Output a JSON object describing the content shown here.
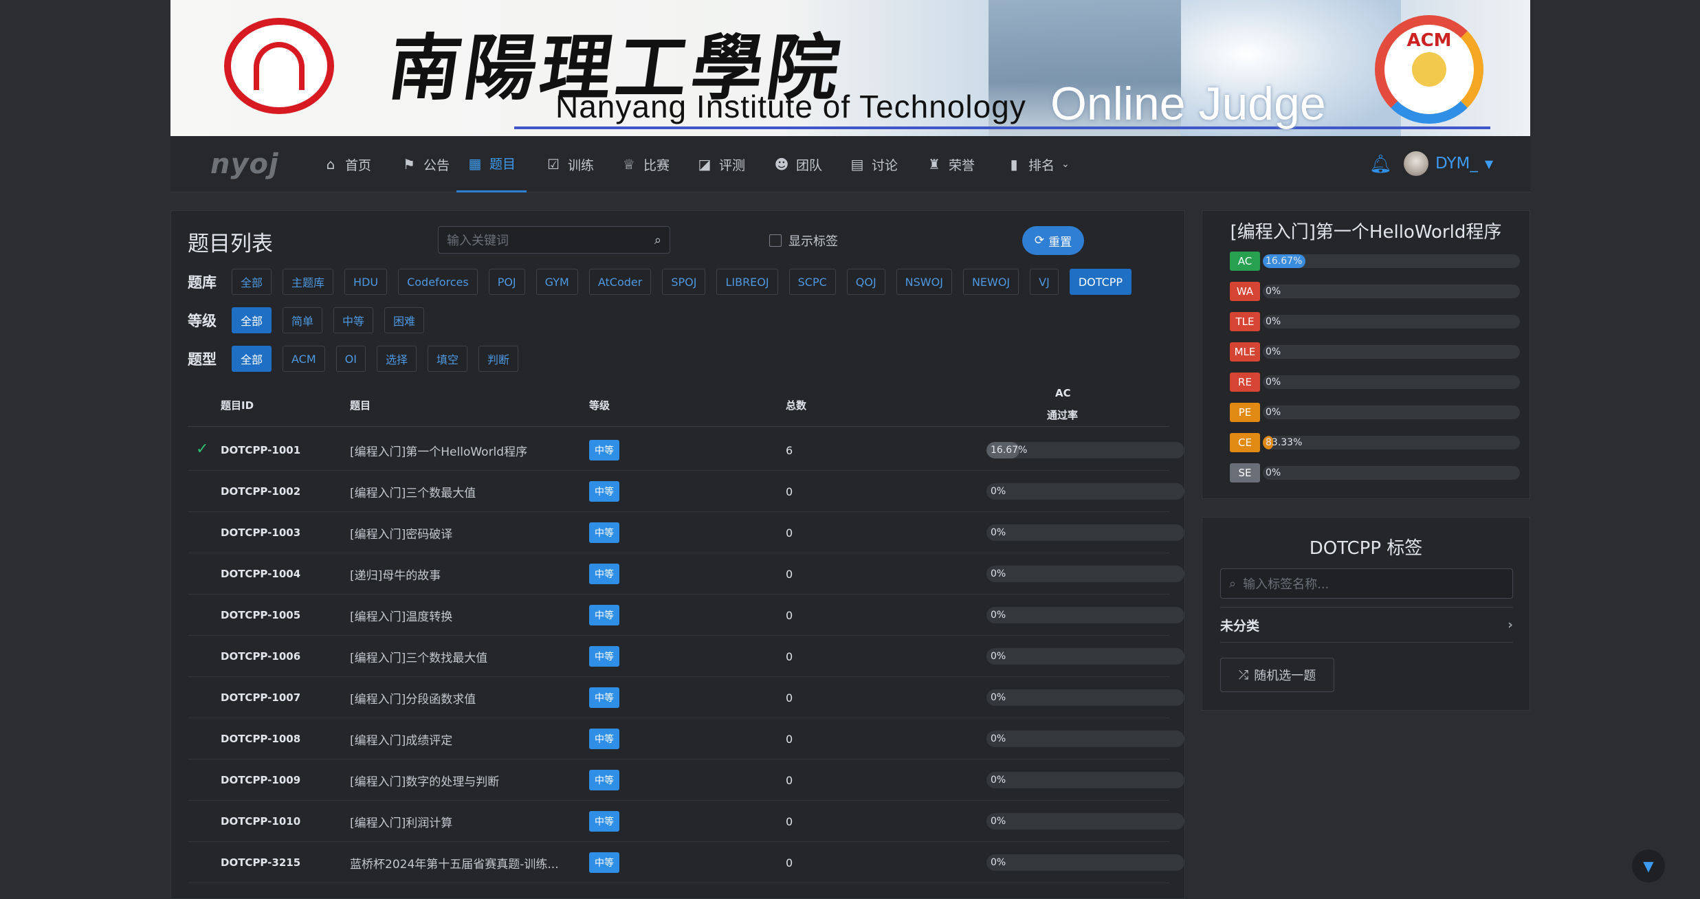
{
  "banner": {
    "calligraphy": "南陽理工學院",
    "school_en": "Nanyang Institute of Technology",
    "oj": "Online Judge",
    "acm": "ACM"
  },
  "nav": {
    "logo": "nyoj",
    "items": [
      {
        "label": "首页",
        "icon": "home-icon"
      },
      {
        "label": "公告",
        "icon": "flag-icon"
      },
      {
        "label": "题目",
        "icon": "grid-icon"
      },
      {
        "label": "训练",
        "icon": "clipboard-check-icon"
      },
      {
        "label": "比赛",
        "icon": "trophy-icon"
      },
      {
        "label": "评测",
        "icon": "chart-icon"
      },
      {
        "label": "团队",
        "icon": "users-icon"
      },
      {
        "label": "讨论",
        "icon": "comment-icon"
      },
      {
        "label": "荣誉",
        "icon": "medal-icon"
      },
      {
        "label": "排名",
        "icon": "bar-chart-icon"
      }
    ],
    "active": "题目",
    "user": "DYM_"
  },
  "main": {
    "title": "题目列表",
    "search_placeholder": "输入关键词",
    "show_tags": "显示标签",
    "reset": "重置",
    "filters": {
      "source_label": "题库",
      "sources": [
        "全部",
        "主题库",
        "HDU",
        "Codeforces",
        "POJ",
        "GYM",
        "AtCoder",
        "SPOJ",
        "LIBREOJ",
        "SCPC",
        "QOJ",
        "NSWOJ",
        "NEWOJ",
        "VJ",
        "DOTCPP"
      ],
      "source_active": "DOTCPP",
      "level_label": "等级",
      "levels": [
        "全部",
        "简单",
        "中等",
        "困难"
      ],
      "level_active": "全部",
      "type_label": "题型",
      "types": [
        "全部",
        "ACM",
        "OI",
        "选择",
        "填空",
        "判断"
      ],
      "type_active": "全部"
    },
    "columns": {
      "id": "题目ID",
      "title": "题目",
      "level": "等级",
      "total": "总数",
      "ac_top": "AC",
      "ac_bottom": "通过率"
    },
    "rows": [
      {
        "id": "DOTCPP-1001",
        "title": "[编程入门]第一个HelloWorld程序",
        "level": "中等",
        "total": "6",
        "rate": "16.67%",
        "rate_value": 16.67,
        "solved": true
      },
      {
        "id": "DOTCPP-1002",
        "title": "[编程入门]三个数最大值",
        "level": "中等",
        "total": "0",
        "rate": "0%",
        "rate_value": 0,
        "solved": false
      },
      {
        "id": "DOTCPP-1003",
        "title": "[编程入门]密码破译",
        "level": "中等",
        "total": "0",
        "rate": "0%",
        "rate_value": 0,
        "solved": false
      },
      {
        "id": "DOTCPP-1004",
        "title": "[递归]母牛的故事",
        "level": "中等",
        "total": "0",
        "rate": "0%",
        "rate_value": 0,
        "solved": false
      },
      {
        "id": "DOTCPP-1005",
        "title": "[编程入门]温度转换",
        "level": "中等",
        "total": "0",
        "rate": "0%",
        "rate_value": 0,
        "solved": false
      },
      {
        "id": "DOTCPP-1006",
        "title": "[编程入门]三个数找最大值",
        "level": "中等",
        "total": "0",
        "rate": "0%",
        "rate_value": 0,
        "solved": false
      },
      {
        "id": "DOTCPP-1007",
        "title": "[编程入门]分段函数求值",
        "level": "中等",
        "total": "0",
        "rate": "0%",
        "rate_value": 0,
        "solved": false
      },
      {
        "id": "DOTCPP-1008",
        "title": "[编程入门]成绩评定",
        "level": "中等",
        "total": "0",
        "rate": "0%",
        "rate_value": 0,
        "solved": false
      },
      {
        "id": "DOTCPP-1009",
        "title": "[编程入门]数字的处理与判断",
        "level": "中等",
        "total": "0",
        "rate": "0%",
        "rate_value": 0,
        "solved": false
      },
      {
        "id": "DOTCPP-1010",
        "title": "[编程入门]利润计算",
        "level": "中等",
        "total": "0",
        "rate": "0%",
        "rate_value": 0,
        "solved": false
      },
      {
        "id": "DOTCPP-3215",
        "title": "蓝桥杯2024年第十五届省赛真题-训练...",
        "level": "中等",
        "total": "0",
        "rate": "0%",
        "rate_value": 0,
        "solved": false
      }
    ]
  },
  "stats": {
    "title": "[编程入门]第一个HelloWorld程序",
    "items": [
      {
        "label": "AC",
        "value": "16.67%",
        "pct": 16.67,
        "color": "#27a04f"
      },
      {
        "label": "WA",
        "value": "0%",
        "pct": 0,
        "color": "#d64533"
      },
      {
        "label": "TLE",
        "value": "0%",
        "pct": 0,
        "color": "#d64533"
      },
      {
        "label": "MLE",
        "value": "0%",
        "pct": 0,
        "color": "#d64533"
      },
      {
        "label": "RE",
        "value": "0%",
        "pct": 0,
        "color": "#d64533"
      },
      {
        "label": "PE",
        "value": "0%",
        "pct": 0,
        "color": "#e08a14"
      },
      {
        "label": "CE",
        "value": "83.33%",
        "pct": 83.33,
        "color": "#e08a14"
      },
      {
        "label": "SE",
        "value": "0%",
        "pct": 0,
        "color": "#6a6f77"
      }
    ]
  },
  "tags": {
    "title": "DOTCPP 标签",
    "placeholder": "输入标签名称...",
    "uncategorized": "未分类",
    "random": "随机选一题"
  }
}
